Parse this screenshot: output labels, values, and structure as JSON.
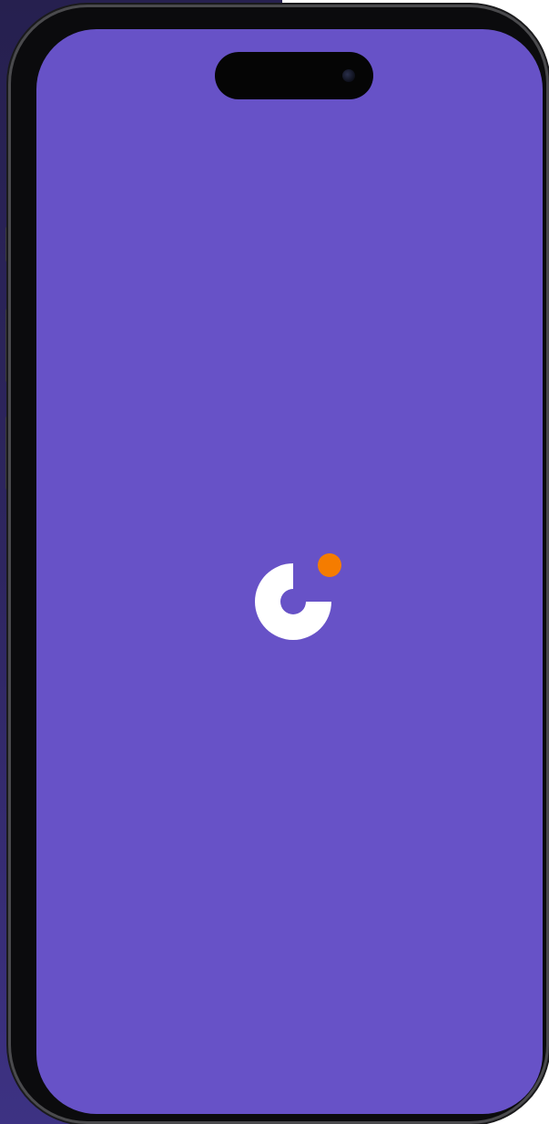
{
  "screen": {
    "background_color": "#6752c7",
    "state": "splash"
  },
  "logo": {
    "icon": "app-logo-icon",
    "ring_color": "#ffffff",
    "dot_color": "#f57c00"
  },
  "device": {
    "frame_color": "#0b0b0d",
    "backdrop_color": "#2e2660"
  }
}
